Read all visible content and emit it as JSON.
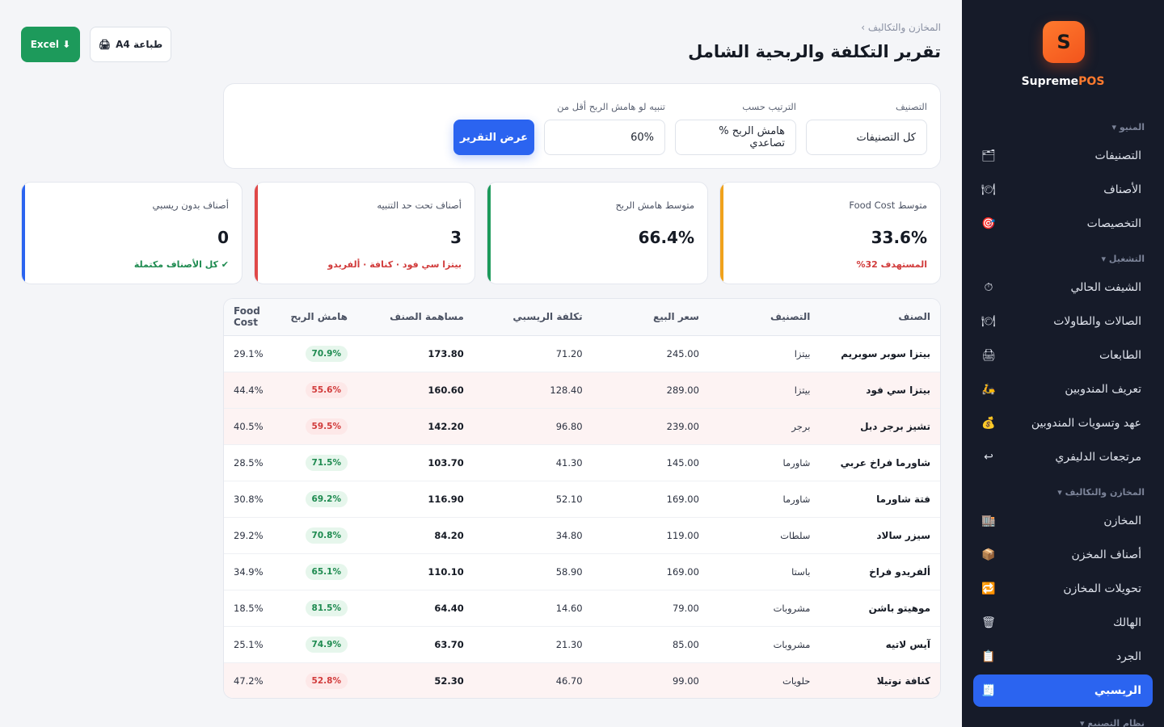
{
  "brand": {
    "badge_letter": "S",
    "name_main": "Supreme",
    "name_accent": "POS"
  },
  "sidebar": {
    "sections": [
      {
        "label": "المنيو ▾"
      },
      {
        "label": "التشغيل ▾"
      },
      {
        "label": "المخازن والتكاليف ▾"
      }
    ],
    "items": [
      {
        "label": "التصنيفات",
        "icon": "folder-icon",
        "glyph": "🗂"
      },
      {
        "label": "الأصناف",
        "icon": "plate-icon",
        "glyph": "🍽"
      },
      {
        "label": "التخصيصات",
        "icon": "target-icon",
        "glyph": "🎯"
      },
      {
        "label": "الشيفت الحالي",
        "icon": "timer-icon",
        "glyph": "⏱"
      },
      {
        "label": "الصالات والطاولات",
        "icon": "table-icon",
        "glyph": "🍽"
      },
      {
        "label": "الطابعات",
        "icon": "printer-icon",
        "glyph": "🖨"
      },
      {
        "label": "تعريف المندوبين",
        "icon": "scooter-icon",
        "glyph": "🛵"
      },
      {
        "label": "عهد وتسويات المندوبين",
        "icon": "money-bag-icon",
        "glyph": "💰"
      },
      {
        "label": "مرتجعات الدليفري",
        "icon": "return-icon",
        "glyph": "↩"
      },
      {
        "label": "المخازن",
        "icon": "warehouse-icon",
        "glyph": "🏬"
      },
      {
        "label": "أصناف المخزن",
        "icon": "box-icon",
        "glyph": "📦"
      },
      {
        "label": "تحويلات المخازن",
        "icon": "transfer-icon",
        "glyph": "🔁"
      },
      {
        "label": "الهالك",
        "icon": "trash-icon",
        "glyph": "🗑"
      },
      {
        "label": "الجرد",
        "icon": "clipboard-icon",
        "glyph": "📋"
      },
      {
        "label": "الريسبي",
        "icon": "recipe-icon",
        "glyph": "🧾"
      }
    ],
    "cut_off_section": "نظام التصنيع ▾"
  },
  "header": {
    "breadcrumb": "المخازن والتكاليف ›",
    "title": "تقرير التكلفة والربحية الشامل",
    "excel_label": "Excel ⬇",
    "print_label": "طباعة A4",
    "print_icon": "🖨"
  },
  "filters": {
    "category_label": "التصنيف",
    "category_value": "كل التصنيفات",
    "sort_label": "الترتيب حسب",
    "sort_value": "هامش الربح % تصاعدي",
    "alert_label": "تنبيه لو هامش الربح أقل من",
    "alert_value": "60%",
    "show_button": "عرض التقرير"
  },
  "kpis": [
    {
      "label": "متوسط Food Cost",
      "value": "33.6%",
      "note": "المستهدف 32%",
      "accent": "#f0a21c",
      "note_color": "#d13b3b"
    },
    {
      "label": "متوسط هامش الربح",
      "value": "66.4%",
      "note": "",
      "accent": "#1d9a5b",
      "note_color": "#1d8a4f"
    },
    {
      "label": "أصناف تحت حد التنبيه",
      "value": "3",
      "note": "بيتزا سي فود · كنافة · ألفريدو",
      "accent": "#e04848",
      "note_color": "#d13b3b"
    },
    {
      "label": "أصناف بدون ريسبي",
      "value": "0",
      "note": "✔ كل الأصناف مكتملة",
      "accent": "#2b64f0",
      "note_color": "#1d8a4f"
    }
  ],
  "table": {
    "headers": [
      "الصنف",
      "التصنيف",
      "سعر البيع",
      "تكلفة الريسبي",
      "مساهمة الصنف",
      "هامش الربح",
      "Food Cost"
    ],
    "rows": [
      {
        "item": "بيتزا سوبر سوبريم",
        "category": "بيتزا",
        "price": "245.00",
        "cost": "71.20",
        "contribution": "173.80",
        "margin": "70.9%",
        "food_cost": "29.1%",
        "warn": false
      },
      {
        "item": "بيتزا سي فود",
        "category": "بيتزا",
        "price": "289.00",
        "cost": "128.40",
        "contribution": "160.60",
        "margin": "55.6%",
        "food_cost": "44.4%",
        "warn": true
      },
      {
        "item": "تشيز برجر دبل",
        "category": "برجر",
        "price": "239.00",
        "cost": "96.80",
        "contribution": "142.20",
        "margin": "59.5%",
        "food_cost": "40.5%",
        "warn": true
      },
      {
        "item": "شاورما فراخ عربي",
        "category": "شاورما",
        "price": "145.00",
        "cost": "41.30",
        "contribution": "103.70",
        "margin": "71.5%",
        "food_cost": "28.5%",
        "warn": false
      },
      {
        "item": "فتة شاورما",
        "category": "شاورما",
        "price": "169.00",
        "cost": "52.10",
        "contribution": "116.90",
        "margin": "69.2%",
        "food_cost": "30.8%",
        "warn": false
      },
      {
        "item": "سيزر سالاد",
        "category": "سلطات",
        "price": "119.00",
        "cost": "34.80",
        "contribution": "84.20",
        "margin": "70.8%",
        "food_cost": "29.2%",
        "warn": false
      },
      {
        "item": "ألفريدو فراخ",
        "category": "باستا",
        "price": "169.00",
        "cost": "58.90",
        "contribution": "110.10",
        "margin": "65.1%",
        "food_cost": "34.9%",
        "warn": false
      },
      {
        "item": "موهيتو باشن",
        "category": "مشروبات",
        "price": "79.00",
        "cost": "14.60",
        "contribution": "64.40",
        "margin": "81.5%",
        "food_cost": "18.5%",
        "warn": false
      },
      {
        "item": "آيس لاتيه",
        "category": "مشروبات",
        "price": "85.00",
        "cost": "21.30",
        "contribution": "63.70",
        "margin": "74.9%",
        "food_cost": "25.1%",
        "warn": false
      },
      {
        "item": "كنافة نوتيلا",
        "category": "حلويات",
        "price": "99.00",
        "cost": "46.70",
        "contribution": "52.30",
        "margin": "52.8%",
        "food_cost": "47.2%",
        "warn": true
      }
    ]
  }
}
